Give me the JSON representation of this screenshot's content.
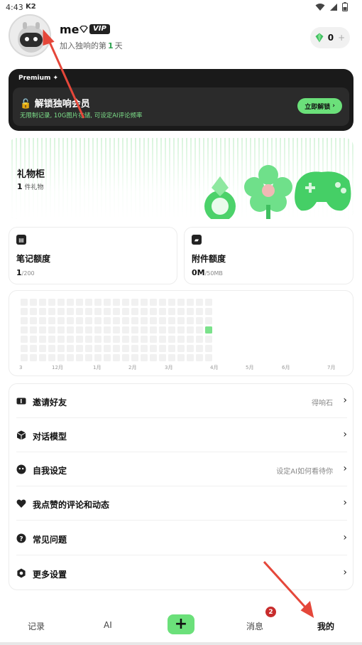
{
  "status_bar": {
    "time": "4:43",
    "carrier": "K2"
  },
  "profile": {
    "name": "me",
    "vip_label": "VIP",
    "join_prefix": "加入独响的第",
    "join_days": "1",
    "join_suffix": "天",
    "gems": "0",
    "gems_plus": "+"
  },
  "premium": {
    "label": "Premium",
    "title": "解锁独响会员",
    "description": "无限制记录, 10G图片存储, 可设定AI评论频率",
    "cta": "立即解锁"
  },
  "gift_cabinet": {
    "title": "礼物柜",
    "count": "1",
    "count_suffix": "件礼物"
  },
  "quotas": {
    "notes": {
      "title": "笔记额度",
      "value": "1",
      "limit": "/200"
    },
    "attachments": {
      "title": "附件额度",
      "value": "0M",
      "limit": "/50MB"
    }
  },
  "heatmap": {
    "month_labels": [
      "3",
      "12月",
      "1月",
      "2月",
      "3月",
      "4月",
      "5月",
      "6月",
      "7月"
    ],
    "active_cells": [
      {
        "week": 20,
        "day": 3
      }
    ],
    "active_color": "#7be28b",
    "empty_color": "#f1f1f1"
  },
  "menu": [
    {
      "label": "邀请好友",
      "hint": "得响石",
      "icon": "ticket-icon"
    },
    {
      "label": "对话模型",
      "hint": "",
      "icon": "cube-icon"
    },
    {
      "label": "自我设定",
      "hint": "设定AI如何看待你",
      "icon": "face-icon"
    },
    {
      "label": "我点赞的评论和动态",
      "hint": "",
      "icon": "heart-icon"
    },
    {
      "label": "常见问题",
      "hint": "",
      "icon": "question-icon"
    },
    {
      "label": "更多设置",
      "hint": "",
      "icon": "settings-icon"
    }
  ],
  "tabbar": {
    "tabs": [
      "记录",
      "AI",
      "消息",
      "我的"
    ],
    "add": "+",
    "messages_badge": "2",
    "active": "我的"
  },
  "colors": {
    "accent": "#6be07a",
    "badge": "#c82c2c",
    "annotation": "#e5473a"
  }
}
